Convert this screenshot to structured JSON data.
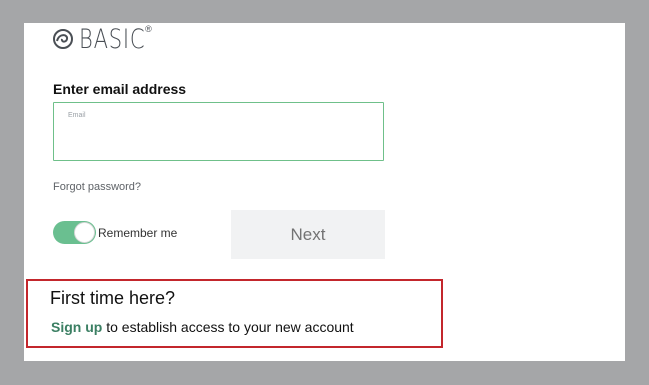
{
  "logo": {
    "text": "BASIC",
    "reg_mark": "®",
    "icon": "basic-swirl-icon"
  },
  "login": {
    "email_label": "Enter email address",
    "email_placeholder": "Email",
    "email_value": "",
    "forgot_label": "Forgot password?",
    "remember_label": "Remember me",
    "remember_on": true,
    "next_label": "Next"
  },
  "signup": {
    "title": "First time here?",
    "link_label": "Sign up",
    "rest_text": " to establish access to your new account"
  },
  "colors": {
    "background": "#a5a6a8",
    "accent_green": "#6abf90",
    "input_border": "#6fc08a",
    "highlight_red": "#c3262c",
    "link_green": "#3b7f63"
  }
}
